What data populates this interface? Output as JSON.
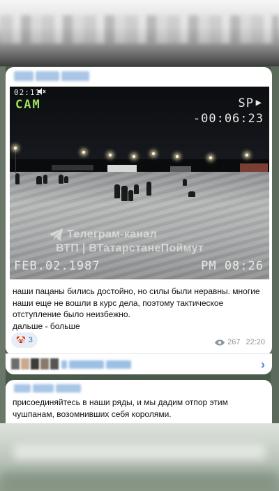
{
  "post": {
    "video_osd": {
      "clock": "02:11",
      "cam_label": "CAM",
      "mode": "SP",
      "counter": "-00:06:23",
      "date": "FEB.02.1987",
      "time": "PM 08:26"
    },
    "watermark": {
      "line1": "Телеграм-канал",
      "line2": "ВТП | ВТатарстанеПоймут"
    },
    "text_lines": [
      "наши пацаны бились достойно, но силы были неравны. многие",
      "наши еще не вошли в курс дела, поэтому тактическое",
      "отступление было неизбежно.",
      "дальше - больше"
    ],
    "reaction": {
      "emoji": "🤡",
      "count": "3"
    },
    "views": "267",
    "timestamp": "22:20"
  },
  "comments": {
    "chevron": "›"
  },
  "next_post": {
    "text_lines": [
      "присоединяйтесь в наши ряды, и мы дадим отпор этим",
      "чушпанам, возомнивших себя королями."
    ]
  },
  "colors": {
    "cam_label": "#9ee35a",
    "accent": "#3d8ee0",
    "meta": "#8e969e",
    "reaction_bg": "#e7eef7"
  }
}
